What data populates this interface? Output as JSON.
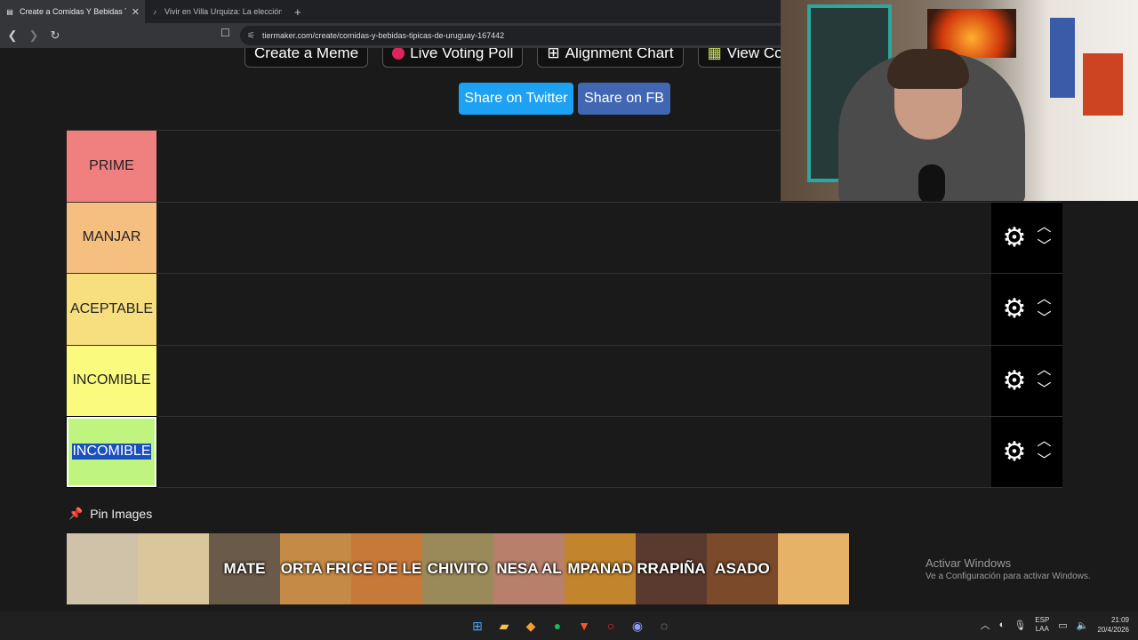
{
  "browser": {
    "tabs": [
      {
        "title": "Create a Comidas Y Bebidas Típi",
        "active": true,
        "icon": "tiermaker-favicon"
      },
      {
        "title": "Vivir en Villa Urquiza: La elección per",
        "active": false,
        "icon": "tiktok-favicon"
      }
    ],
    "new_tab_symbol": "+",
    "url": "tiermaker.com/create/comidas-y-bebidas-tipicas-de-uruguay-167442"
  },
  "page": {
    "top_buttons": [
      {
        "label": "Create a Meme"
      },
      {
        "label": "Live Voting Poll"
      },
      {
        "label": "Alignment Chart"
      },
      {
        "label": "View Co"
      }
    ],
    "share_twitter": "Share on Twitter",
    "share_fb": "Share on FB",
    "tiers": [
      {
        "label": "PRIME",
        "color": "#f07f7f"
      },
      {
        "label": "MANJAR",
        "color": "#f5bf7f"
      },
      {
        "label": "ACEPTABLE",
        "color": "#f7df7f"
      },
      {
        "label": "INCOMIBLE",
        "color": "#fafa7f"
      },
      {
        "label": "INCOMIBLE",
        "color": "#bff57f",
        "selected": true
      }
    ],
    "pin_images_label": "Pin Images",
    "images": [
      {
        "caption": "",
        "bg": "#cfc2a8"
      },
      {
        "caption": "",
        "bg": "#d9c69a"
      },
      {
        "caption": "MATE",
        "bg": "#6a5a4a"
      },
      {
        "caption": "ORTA FRI",
        "bg": "#c48a46"
      },
      {
        "caption": "CE DE LE",
        "bg": "#c7793a"
      },
      {
        "caption": "CHIVITO",
        "bg": "#9a8a5a"
      },
      {
        "caption": "NESA AL",
        "bg": "#b8806a"
      },
      {
        "caption": "MPANAD",
        "bg": "#c2852e"
      },
      {
        "caption": "RRAPIÑA",
        "bg": "#5a3a2e"
      },
      {
        "caption": "ASADO",
        "bg": "#7a4a2a"
      },
      {
        "caption": "",
        "bg": "#e6b268"
      }
    ]
  },
  "watermark": {
    "line1": "Activar Windows",
    "line2": "Ve a Configuración para activar Windows."
  },
  "taskbar": {
    "icons": [
      "windows-start-icon",
      "file-explorer-icon",
      "app-icon",
      "spotify-icon",
      "brave-icon",
      "opera-icon",
      "discord-icon",
      "app2-icon"
    ],
    "language": "ESP",
    "layout": "LAA",
    "time": "21:09",
    "date": "20/4/2026"
  }
}
